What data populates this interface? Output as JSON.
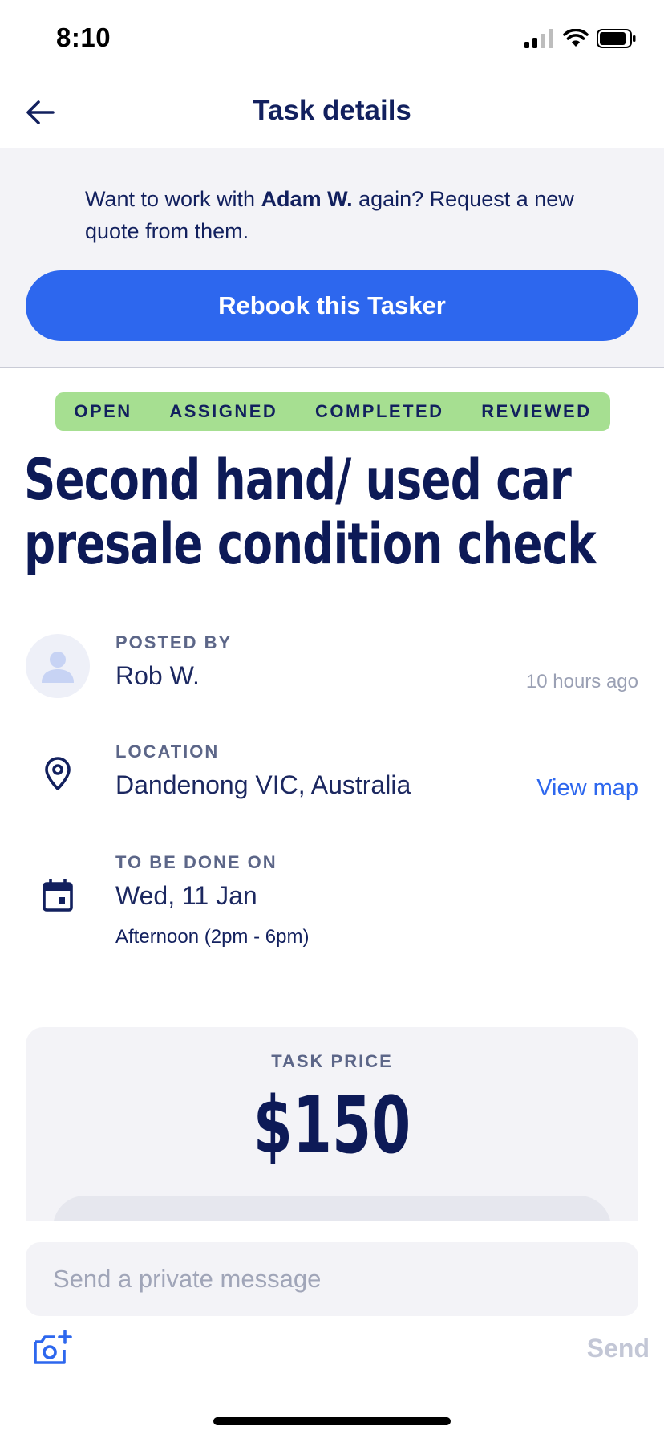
{
  "status_bar": {
    "time": "8:10"
  },
  "header": {
    "title": "Task details"
  },
  "rebook": {
    "text_before": "Want to work with ",
    "name": "Adam W.",
    "text_after": " again? Request a new quote from them.",
    "button_label": "Rebook this Tasker"
  },
  "stepper": {
    "steps": [
      "OPEN",
      "ASSIGNED",
      "COMPLETED",
      "REVIEWED"
    ],
    "color": "#a6df91"
  },
  "task": {
    "title": "Second hand/ used car presale condition check"
  },
  "posted_by": {
    "label": "POSTED BY",
    "value": "Rob W.",
    "time_ago": "10 hours ago"
  },
  "location": {
    "label": "LOCATION",
    "value": "Dandenong VIC, Australia",
    "link": "View map"
  },
  "due": {
    "label": "TO BE DONE ON",
    "value": "Wed, 11 Jan",
    "sub": "Afternoon (2pm - 6pm)"
  },
  "price": {
    "label": "TASK PRICE",
    "value": "$150"
  },
  "message": {
    "placeholder": "Send a private message",
    "send_label": "Send"
  },
  "icons": {
    "back": "arrow-left-icon",
    "avatar": "user-avatar-icon",
    "location": "map-pin-icon",
    "calendar": "calendar-icon",
    "camera": "add-photo-icon"
  },
  "colors": {
    "accent": "#2d67ee",
    "text_dark": "#12205e",
    "muted": "#5c6688"
  }
}
